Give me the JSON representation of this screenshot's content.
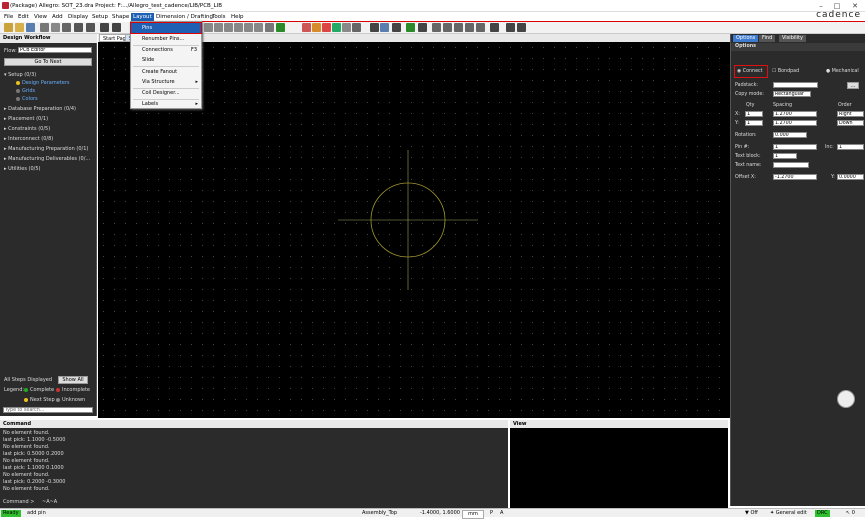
{
  "window": {
    "title": "(Package) Allegro: SOT_23.dra  Project: F:.../Allegro_test_cadence/LIB/PCB_LIB",
    "brand": "cadence",
    "minimize": "–",
    "maximize": "□",
    "close": "✕"
  },
  "menu": [
    "File",
    "Edit",
    "View",
    "Add",
    "Display",
    "Setup",
    "Shape",
    "Layout",
    "Dimension / Drafting",
    "Tools",
    "Help"
  ],
  "layout_menu": {
    "items": [
      {
        "label": "Pins",
        "shortcut": ""
      },
      {
        "label": "Renumber Pins...",
        "shortcut": ""
      },
      {
        "label": "Connections",
        "shortcut": "F3"
      },
      {
        "label": "Slide",
        "shortcut": ""
      },
      {
        "label": "Create Fanout",
        "shortcut": ""
      },
      {
        "label": "Via Structure",
        "shortcut": "▸"
      },
      {
        "label": "Coil Designer...",
        "shortcut": ""
      },
      {
        "label": "Labels",
        "shortcut": "▸"
      }
    ]
  },
  "workflow": {
    "title": "Design Workflow",
    "flow_label": "Flow:",
    "flow_value": "PCB Editor",
    "go_next": "Go To Next",
    "steps": [
      {
        "label": "Setup (0/3)",
        "subs": [
          "Design Parameters",
          "Grids",
          "Colors"
        ]
      },
      {
        "label": "Database Preparation (0/4)"
      },
      {
        "label": "Placement (0/1)"
      },
      {
        "label": "Constraints (0/5)"
      },
      {
        "label": "Interconnect (0/8)"
      },
      {
        "label": "Manufacturing Preparation (0/1)"
      },
      {
        "label": "Manufacturing Deliverables (0/..."
      },
      {
        "label": "Utilities (0/5)"
      }
    ],
    "all_steps": "All Steps Displayed",
    "show_all": "Show All",
    "legend": "Legend:",
    "complete": "Complete",
    "incomplete": "Incomplete",
    "next_step": "Next Step",
    "unknown": "Unknown",
    "search_placeholder": "Type to search..."
  },
  "tabs": [
    "Start Page",
    "S"
  ],
  "options": {
    "tabs": [
      "Options",
      "Find",
      "Visibility"
    ],
    "title": "Options",
    "connect": "Connect",
    "bondpad": "Bondpad",
    "mechanical": "Mechanical",
    "padstack": "Padstack:",
    "copy_mode": "Copy mode:",
    "copy_mode_value": "Rectangular",
    "qty": "Qty",
    "spacing": "Spacing",
    "order": "Order",
    "x_label": "X:",
    "y_label": "Y:",
    "x_qty": "1",
    "y_qty": "1",
    "x_spacing": "1.2700",
    "y_spacing": "1.2700",
    "x_order": "Right",
    "y_order": "Down",
    "rotation": "Rotation:",
    "rotation_value": "0.000",
    "pin_no": "Pin #:",
    "pin_value": "1",
    "inc": "Inc:",
    "inc_value": "1",
    "text_block": "Text block:",
    "text_block_value": "1",
    "text_name": "Text name:",
    "offset_x": "Offset X:",
    "offset_x_value": "-1.2700",
    "offset_y": "Y:",
    "offset_y_value": "0.0000"
  },
  "command": {
    "title": "Command",
    "lines": [
      "No element found.",
      "last pick:  1.1000 -0.5000",
      "No element found.",
      "last pick:  0.5000 0.2000",
      "No element found.",
      "last pick:  1.1000 0.1000",
      "No element found.",
      "last pick:  0.2000 -0.3000",
      "No element found."
    ],
    "prompt": "Command >",
    "input_value": "~A~A"
  },
  "view": {
    "title": "View"
  },
  "status": {
    "ready": "Ready",
    "action": "add pin",
    "layer": "Assembly_Top",
    "coords": "-1.4000, 1.6000",
    "units": "mm",
    "p": "P",
    "a": "A",
    "off": "Off",
    "general_edit": "General edit",
    "drc": "DRC",
    "count": "0"
  }
}
